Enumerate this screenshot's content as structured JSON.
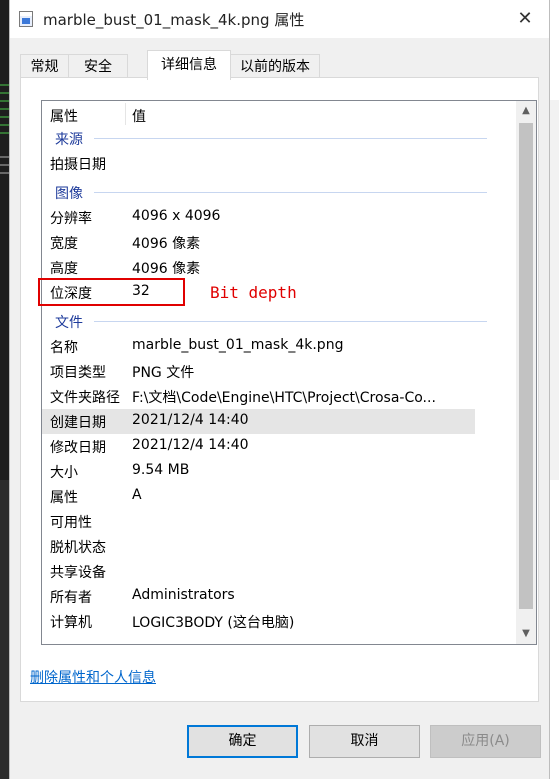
{
  "window": {
    "title": "marble_bust_01_mask_4k.png 属性",
    "close_glyph": "✕"
  },
  "tabs": [
    {
      "label": "常规"
    },
    {
      "label": "安全"
    },
    {
      "label": "详细信息",
      "active": true
    },
    {
      "label": "以前的版本"
    }
  ],
  "details": {
    "header": {
      "property": "属性",
      "value": "值"
    },
    "groups": {
      "source": "来源",
      "image": "图像",
      "file": "文件"
    },
    "rows": {
      "date_taken": {
        "key": "拍摄日期",
        "value": ""
      },
      "resolution": {
        "key": "分辨率",
        "value": "4096 x 4096"
      },
      "width": {
        "key": "宽度",
        "value": "4096 像素"
      },
      "height": {
        "key": "高度",
        "value": "4096 像素"
      },
      "bit_depth": {
        "key": "位深度",
        "value": "32"
      },
      "name": {
        "key": "名称",
        "value": "marble_bust_01_mask_4k.png"
      },
      "item_type": {
        "key": "项目类型",
        "value": "PNG 文件"
      },
      "folder_path": {
        "key": "文件夹路径",
        "value": "F:\\文档\\Code\\Engine\\HTC\\Project\\Crosa-Co..."
      },
      "created": {
        "key": "创建日期",
        "value": "2021/12/4 14:40"
      },
      "modified": {
        "key": "修改日期",
        "value": "2021/12/4 14:40"
      },
      "size": {
        "key": "大小",
        "value": "9.54 MB"
      },
      "attributes": {
        "key": "属性",
        "value": "A"
      },
      "availability": {
        "key": "可用性",
        "value": ""
      },
      "offline_status": {
        "key": "脱机状态",
        "value": ""
      },
      "shared_with": {
        "key": "共享设备",
        "value": ""
      },
      "owner": {
        "key": "所有者",
        "value": "Administrators"
      },
      "computer": {
        "key": "计算机",
        "value": "LOGIC3BODY (这台电脑)"
      }
    }
  },
  "annotation": {
    "text": "Bit depth",
    "color": "#e00000"
  },
  "remove_properties_link": "删除属性和个人信息",
  "buttons": {
    "ok": "确定",
    "cancel": "取消",
    "apply": "应用(A)"
  },
  "colors": {
    "accent": "#0078d7",
    "group_label": "#1e3b9b",
    "link": "#0066cc"
  }
}
